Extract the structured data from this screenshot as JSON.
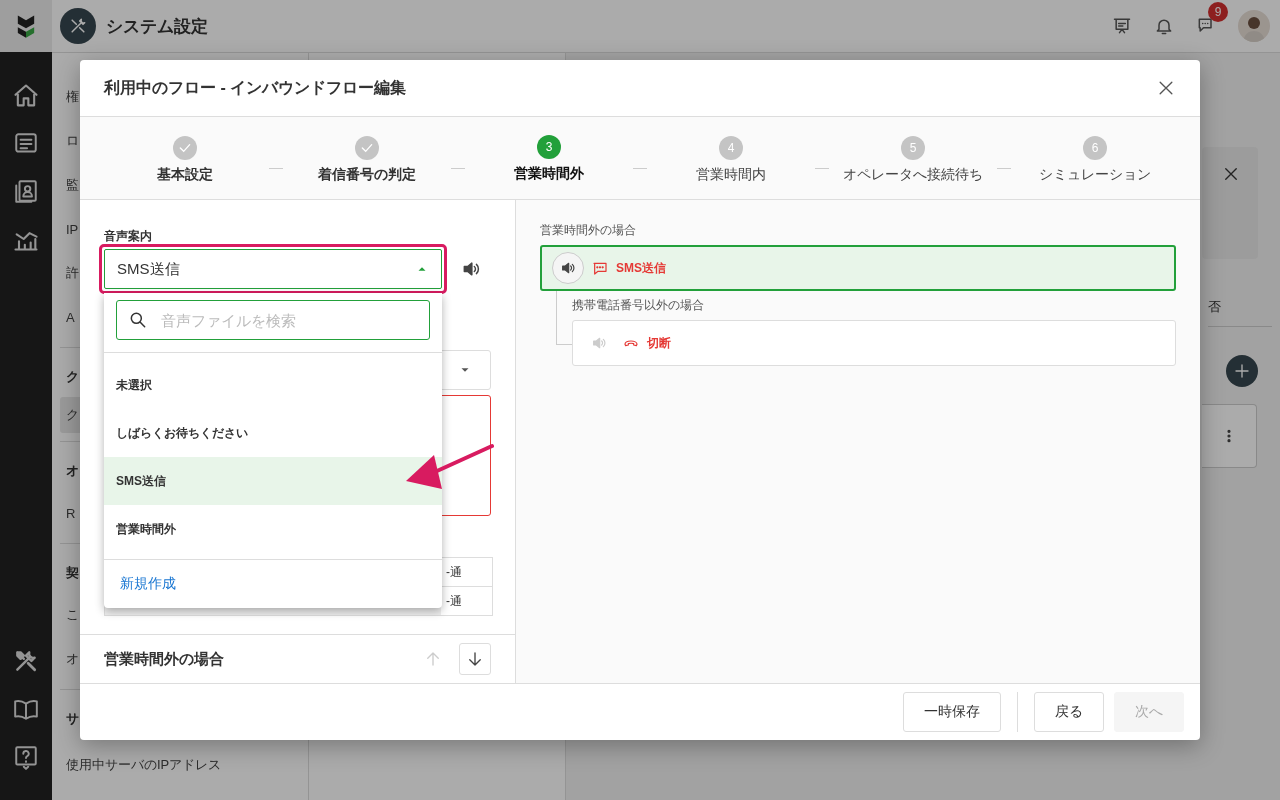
{
  "app": {
    "title": "システム設定",
    "notification_count": "9"
  },
  "sidebar": {
    "items": [
      {
        "kind": "item",
        "label": "権",
        "selected": false
      },
      {
        "kind": "item",
        "label": "ロ",
        "selected": false
      },
      {
        "kind": "item",
        "label": "監",
        "selected": false
      },
      {
        "kind": "item",
        "label": "IP",
        "selected": false
      },
      {
        "kind": "item",
        "label": "許",
        "selected": false
      },
      {
        "kind": "item",
        "label": "A",
        "selected": false
      },
      {
        "kind": "divider"
      },
      {
        "kind": "header",
        "label": "ク"
      },
      {
        "kind": "item",
        "label": "ク",
        "selected": true
      },
      {
        "kind": "divider"
      },
      {
        "kind": "header",
        "label": "オ"
      },
      {
        "kind": "item",
        "label": "R",
        "selected": false
      },
      {
        "kind": "divider"
      },
      {
        "kind": "header",
        "label": "契"
      },
      {
        "kind": "item",
        "label": "こ",
        "selected": false
      },
      {
        "kind": "item",
        "label": "オ",
        "selected": false
      },
      {
        "kind": "divider"
      },
      {
        "kind": "header",
        "label": "サ"
      },
      {
        "kind": "item",
        "label": "使用中サーバのIPアドレス",
        "selected": false
      }
    ]
  },
  "background": {
    "column_label": "否"
  },
  "modal": {
    "title": "利用中のフロー - インバウンドフロー編集",
    "steps": [
      {
        "label": "基本設定",
        "completed": true,
        "selected": false
      },
      {
        "label": "着信番号の判定",
        "completed": true,
        "selected": false
      },
      {
        "label": "営業時間外",
        "number": "3",
        "completed": false,
        "selected": true
      },
      {
        "label": "営業時間内",
        "number": "4",
        "completed": false,
        "selected": false
      },
      {
        "label": "オペレータへ接続待ち",
        "number": "5",
        "completed": false,
        "selected": false
      },
      {
        "label": "シミュレーション",
        "number": "6",
        "completed": false,
        "selected": false
      }
    ],
    "form": {
      "label": "音声案内",
      "value": "SMS送信",
      "expanded": true,
      "search_placeholder": "音声ファイルを検索",
      "options": [
        {
          "label": "未選択",
          "selected": false
        },
        {
          "label": "しばらくお待ちください",
          "selected": false
        },
        {
          "label": "SMS送信",
          "selected": true
        },
        {
          "label": "営業時間外",
          "selected": false
        }
      ],
      "create_link": "新規作成",
      "table_rows": [
        {
          "column_4": "-通"
        },
        {
          "column_4": "-通"
        }
      ]
    },
    "section": {
      "title": "営業時間外の場合",
      "up_disabled": true,
      "down_disabled": false
    },
    "flow": {
      "label": "営業時間外の場合",
      "node": {
        "label": "SMS送信",
        "kind": "sms",
        "selected": true
      },
      "branch": {
        "label": "携帯電話番号以外の場合",
        "node": {
          "label": "切断",
          "kind": "hangup",
          "selected": false
        }
      }
    },
    "footer": {
      "buttons": [
        {
          "label": "一時保存",
          "disabled": false,
          "kind": "secondary"
        },
        {
          "label": "戻る",
          "disabled": false,
          "kind": "secondary"
        },
        {
          "label": "次へ",
          "disabled": true,
          "kind": "primary"
        }
      ]
    }
  }
}
